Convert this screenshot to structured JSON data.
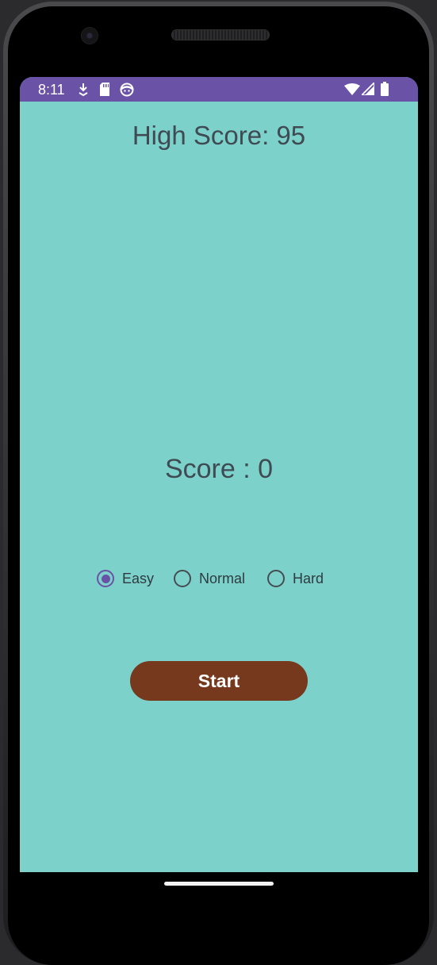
{
  "status_bar": {
    "time": "8:11",
    "left_icons": [
      "download-icon",
      "sd-card-icon",
      "face-icon"
    ],
    "right_icons": [
      "wifi-icon",
      "signal-icon",
      "battery-icon"
    ],
    "color": "#6a52a6"
  },
  "game": {
    "high_score_text": "High Score: 95",
    "score_text": "Score : 0",
    "background_color": "#7cd2cb"
  },
  "difficulty": {
    "options": [
      {
        "label": "Easy",
        "checked": true
      },
      {
        "label": "Normal",
        "checked": false
      },
      {
        "label": "Hard",
        "checked": false
      }
    ],
    "accent_color": "#6a52a6"
  },
  "start_button": {
    "label": "Start",
    "color": "#76391d"
  }
}
